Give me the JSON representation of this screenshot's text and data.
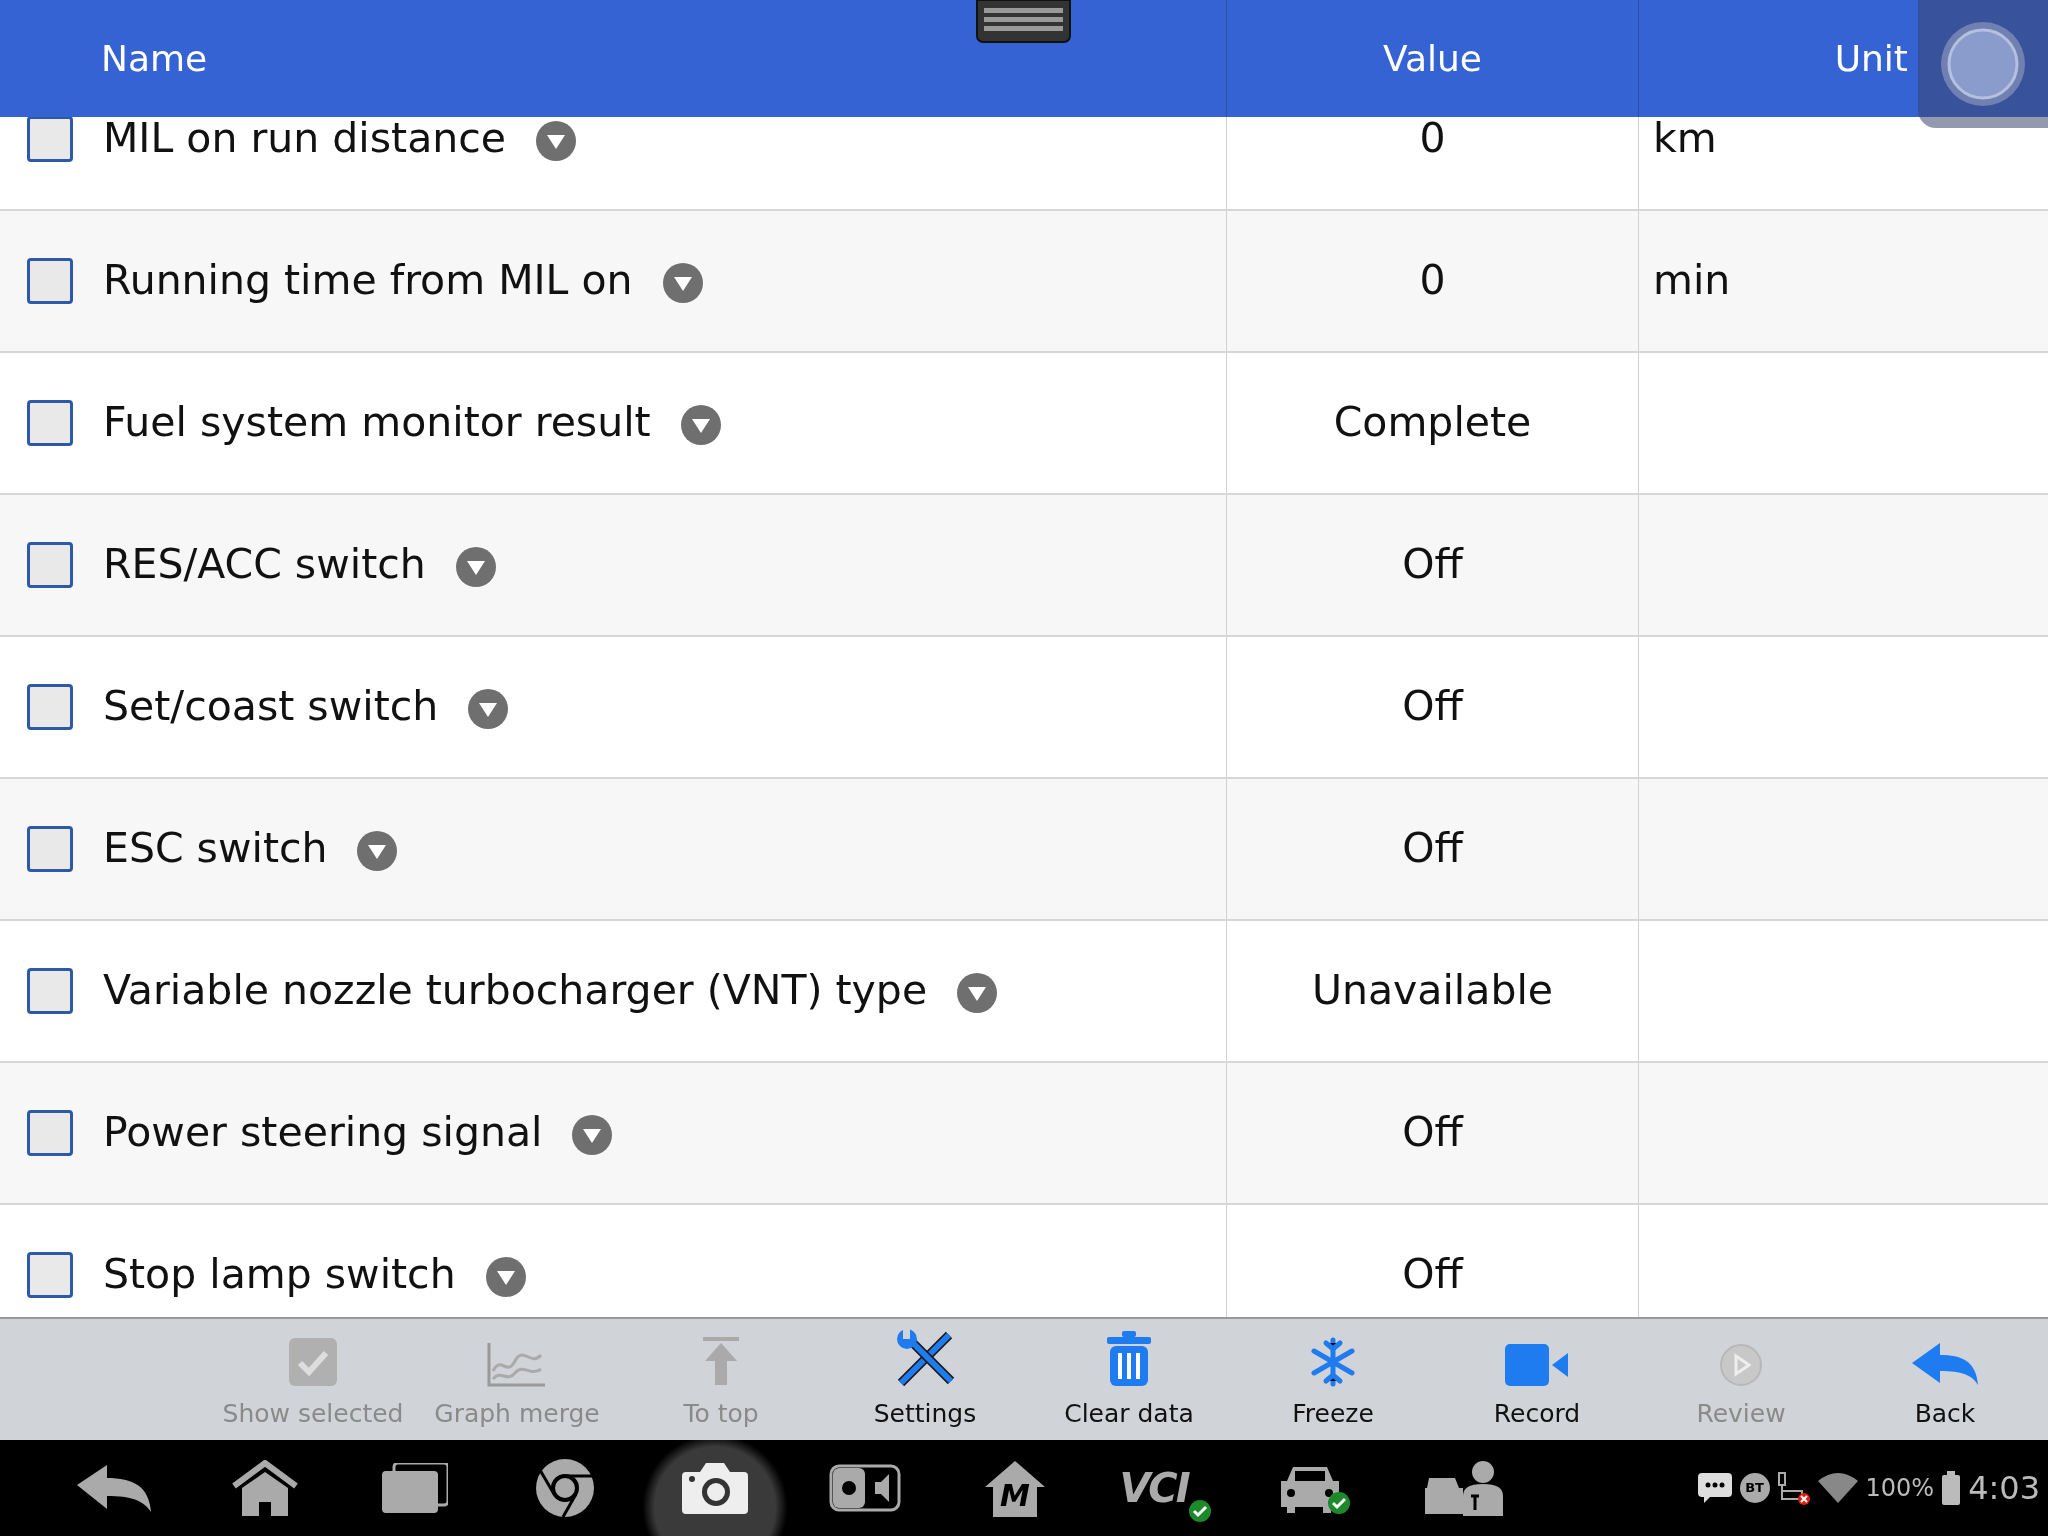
{
  "header": {
    "columns": [
      "Name",
      "Value",
      "Unit"
    ]
  },
  "rows": [
    {
      "name": "MIL on run distance",
      "value": "0",
      "unit": "km",
      "checked": false
    },
    {
      "name": "Running time from MIL on",
      "value": "0",
      "unit": "min",
      "checked": false
    },
    {
      "name": "Fuel system monitor result",
      "value": "Complete",
      "checked": false
    },
    {
      "name": "RES/ACC switch",
      "value": "Off",
      "checked": false
    },
    {
      "name": "Set/coast switch",
      "value": "Off",
      "checked": false
    },
    {
      "name": "ESC switch",
      "value": "Off",
      "checked": false
    },
    {
      "name": "Variable nozzle turbocharger (VNT) type",
      "value": "Unavailable",
      "checked": false
    },
    {
      "name": "Power steering signal",
      "value": "Off",
      "checked": false
    },
    {
      "name": "Stop lamp switch",
      "value": "Off",
      "checked": false
    }
  ],
  "toolbar": [
    {
      "kind": "check",
      "label": "Show selected",
      "disabled": true
    },
    {
      "kind": "graph",
      "label": "Graph merge",
      "disabled": true
    },
    {
      "kind": "top",
      "label": "To top",
      "disabled": true
    },
    {
      "kind": "settings",
      "label": "Settings",
      "disabled": false
    },
    {
      "kind": "trash",
      "label": "Clear data",
      "disabled": false
    },
    {
      "kind": "freeze",
      "label": "Freeze",
      "disabled": false
    },
    {
      "kind": "record",
      "label": "Record",
      "disabled": false
    },
    {
      "kind": "review",
      "label": "Review",
      "disabled": true
    },
    {
      "kind": "back",
      "label": "Back",
      "disabled": false
    }
  ],
  "nav_bar": {
    "items": [
      {
        "kind": "back",
        "selected": false
      },
      {
        "kind": "home",
        "selected": false
      },
      {
        "kind": "recent",
        "selected": false
      },
      {
        "kind": "browser",
        "selected": false
      },
      {
        "kind": "camera",
        "selected": true
      },
      {
        "kind": "display",
        "selected": false
      },
      {
        "kind": "mhome",
        "label": "M",
        "selected": false
      },
      {
        "kind": "vci",
        "label": "VCI",
        "selected": false
      },
      {
        "kind": "car",
        "selected": false
      },
      {
        "kind": "support",
        "selected": false
      }
    ],
    "status": {
      "bt": "BT",
      "battery": "100%",
      "time": "4:03"
    }
  }
}
